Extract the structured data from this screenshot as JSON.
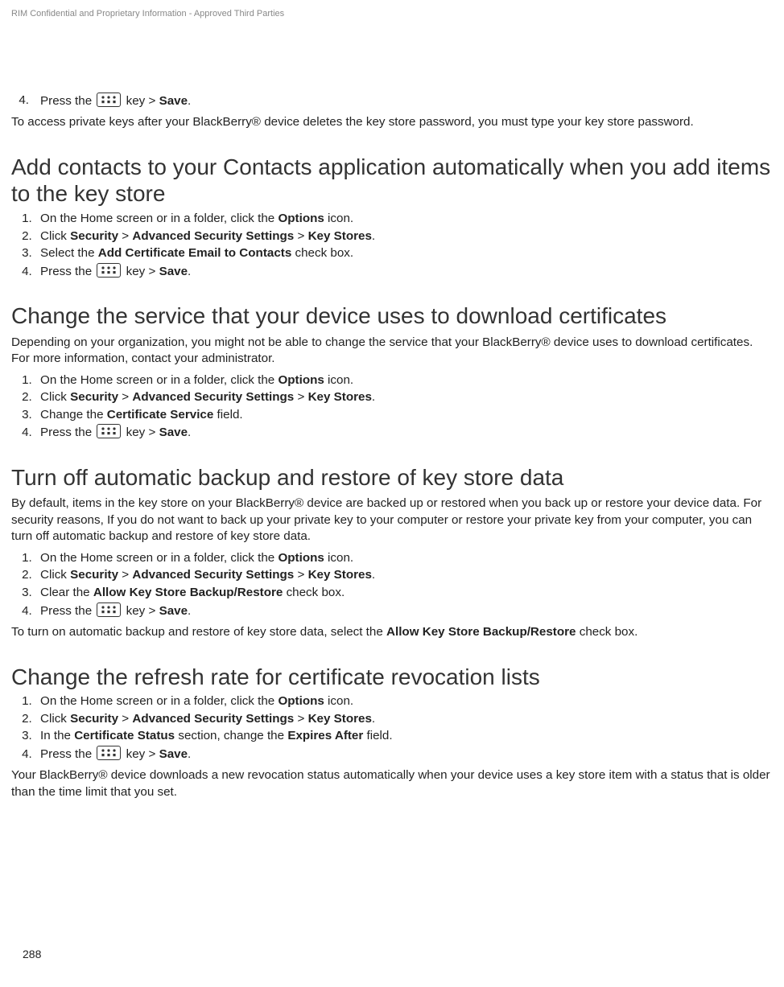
{
  "header": {
    "confidential": "RIM Confidential and Proprietary Information - Approved Third Parties"
  },
  "partial_step": {
    "num": "4.",
    "pre": "Press the ",
    "post": " key > ",
    "save": "Save",
    "dot": "."
  },
  "partial_note": "To access private keys after your BlackBerry® device deletes the key store password, you must type your key store password.",
  "sec1": {
    "heading": "Add contacts to your Contacts application automatically when you add items to the key store",
    "s1a": "On the Home screen or in a folder, click the ",
    "s1b": "Options",
    "s1c": " icon.",
    "s2a": "Click ",
    "s2b": "Security",
    "s2c": " > ",
    "s2d": "Advanced Security Settings",
    "s2e": " > ",
    "s2f": "Key Stores",
    "s2g": ".",
    "s3a": "Select the ",
    "s3b": "Add Certificate Email to Contacts",
    "s3c": " check box."
  },
  "sec2": {
    "heading": "Change the service that your device uses to download certificates",
    "intro": "Depending on your organization, you might not be able to change the service that your BlackBerry® device uses to download certificates. For more information, contact your administrator.",
    "s3a": "Change the ",
    "s3b": "Certificate Service",
    "s3c": " field."
  },
  "sec3": {
    "heading": "Turn off automatic backup and restore of key store data",
    "intro": "By default, items in the key store on your BlackBerry® device are backed up or restored when you back up or restore your device data. For security reasons, If you do not want to back up your private key to your computer or restore your private key from your computer, you can turn off automatic backup and restore of key store data.",
    "s3a": "Clear the ",
    "s3b": "Allow Key Store Backup/Restore",
    "s3c": " check box.",
    "note_a": "To turn on automatic backup and restore of key store data, select the ",
    "note_b": "Allow Key Store Backup/Restore",
    "note_c": " check box."
  },
  "sec4": {
    "heading": "Change the refresh rate for certificate revocation lists",
    "s3a": "In the ",
    "s3b": "Certificate Status",
    "s3c": " section, change the ",
    "s3d": "Expires After",
    "s3e": " field.",
    "note": "Your BlackBerry® device downloads a new revocation status automatically when your device uses a key store item with a status that is older than the time limit that you set."
  },
  "page_number": "288"
}
